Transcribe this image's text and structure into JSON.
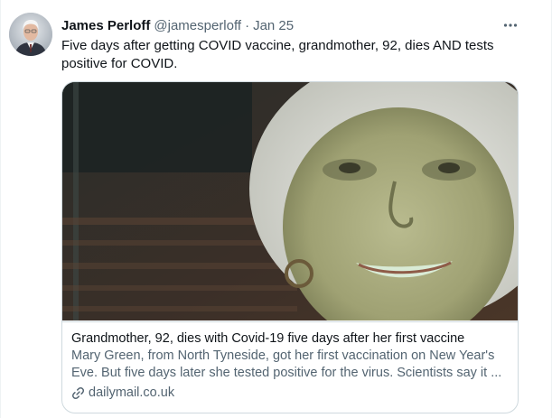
{
  "tweet": {
    "author": {
      "display_name": "James Perloff",
      "handle": "@jamesperloff",
      "avatar_icon": "profile-photo"
    },
    "separator": "·",
    "date": "Jan 25",
    "more_icon": "more-icon",
    "text": "Five days after getting COVID vaccine, grandmother, 92, dies AND tests positive for COVID."
  },
  "card": {
    "image_icon": "photo-of-smiling-elderly-woman",
    "title": "Grandmother, 92, dies with Covid-19 five days after her first vaccine",
    "description": "Mary Green, from North Tyneside, got her first vaccination on New Year's Eve. But five days later she tested positive for the virus. Scientists say it ...",
    "link_icon": "link-icon",
    "domain": "dailymail.co.uk"
  },
  "colors": {
    "text_primary": "#0f1419",
    "text_secondary": "#536471",
    "border": "#cfd9de"
  }
}
